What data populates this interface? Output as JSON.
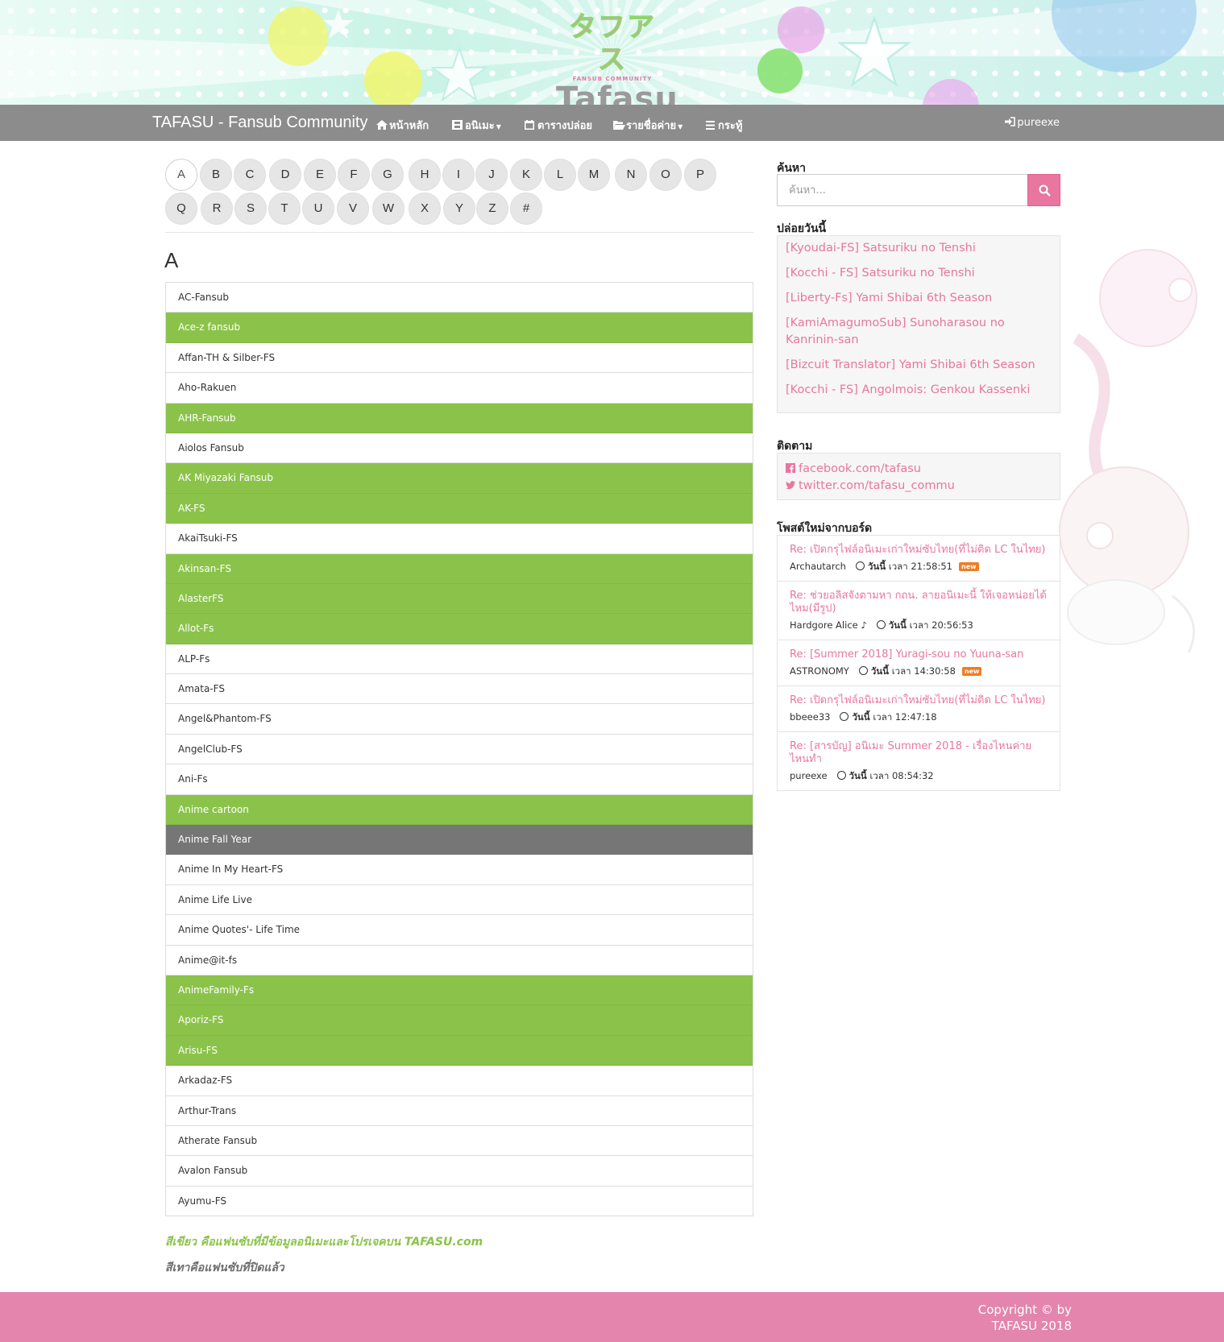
{
  "header": {
    "logo_jp": "タフアス",
    "logo_tagline": "FANSUB COMMUNITY",
    "logo_en": "Tafasu"
  },
  "navbar": {
    "brand": "TAFASU - Fansub Community",
    "items": [
      {
        "label": "หน้าหลัก",
        "icon": "home-icon"
      },
      {
        "label": "อนิเมะ",
        "icon": "film-icon",
        "dropdown": true
      },
      {
        "label": "ตารางปล่อย",
        "icon": "calendar-icon"
      },
      {
        "label": "รายชื่อค่าย",
        "icon": "folder-open-icon",
        "dropdown": true
      },
      {
        "label": "กระทู้",
        "icon": "list-icon"
      }
    ],
    "user": {
      "label": "pureexe",
      "icon": "sign-in-icon"
    }
  },
  "letters": [
    "A",
    "B",
    "C",
    "D",
    "E",
    "F",
    "G",
    "H",
    "I",
    "J",
    "K",
    "L",
    "M",
    "N",
    "O",
    "P",
    "Q",
    "R",
    "S",
    "T",
    "U",
    "V",
    "W",
    "X",
    "Y",
    "Z",
    "#"
  ],
  "active_letter": "A",
  "section_heading": "A",
  "fansubs": [
    {
      "name": "AC-Fansub",
      "status": "default"
    },
    {
      "name": "Ace-z fansub",
      "status": "green"
    },
    {
      "name": "Affan-TH & Silber-FS",
      "status": "default"
    },
    {
      "name": "Aho-Rakuen",
      "status": "default"
    },
    {
      "name": "AHR-Fansub",
      "status": "green"
    },
    {
      "name": "Aiolos Fansub",
      "status": "default"
    },
    {
      "name": "AK Miyazaki Fansub",
      "status": "green"
    },
    {
      "name": "AK-FS",
      "status": "green"
    },
    {
      "name": "AkaiTsuki-FS",
      "status": "default"
    },
    {
      "name": "Akinsan-FS",
      "status": "green"
    },
    {
      "name": "AlasterFS",
      "status": "green"
    },
    {
      "name": "Allot-Fs",
      "status": "green"
    },
    {
      "name": "ALP-Fs",
      "status": "default"
    },
    {
      "name": "Amata-FS",
      "status": "default"
    },
    {
      "name": "Angel&Phantom-FS",
      "status": "default"
    },
    {
      "name": "AngelClub-FS",
      "status": "default"
    },
    {
      "name": "Ani-Fs",
      "status": "default"
    },
    {
      "name": "Anime cartoon",
      "status": "green"
    },
    {
      "name": "Anime Fall Year",
      "status": "gray"
    },
    {
      "name": "Anime In My Heart-FS",
      "status": "default"
    },
    {
      "name": "Anime Life Live",
      "status": "default"
    },
    {
      "name": "Anime Quotes'- Life Time",
      "status": "default"
    },
    {
      "name": "Anime@it-fs",
      "status": "default"
    },
    {
      "name": "AnimeFamily-Fs",
      "status": "green"
    },
    {
      "name": "Aporiz-FS",
      "status": "green"
    },
    {
      "name": "Arisu-FS",
      "status": "green"
    },
    {
      "name": "Arkadaz-FS",
      "status": "default"
    },
    {
      "name": "Arthur-Trans",
      "status": "default"
    },
    {
      "name": "Atherate Fansub",
      "status": "default"
    },
    {
      "name": "Avalon Fansub",
      "status": "default"
    },
    {
      "name": "Ayumu-FS",
      "status": "default"
    }
  ],
  "legend": {
    "green": "สีเขียว คือแฟนซับที่มีข้อมูลอนิเมะและโปรเจคบน TAFASU.com",
    "gray": "สีเทาคือแฟนซับที่ปิดแล้ว"
  },
  "sidebar": {
    "search": {
      "title": "ค้นหา",
      "placeholder": "ค้นหา...",
      "button_icon": "search-icon"
    },
    "today": {
      "title": "ปล่อยวันนี้",
      "items": [
        "[Kyoudai-FS] Satsuriku no Tenshi",
        "[Kocchi - FS] Satsuriku no Tenshi",
        "[Liberty-Fs] Yami Shibai 6th Season",
        "[KamiAmagumoSub] Sunoharasou no Kanrinin-san",
        "[Bizcuit Translator] Yami Shibai 6th Season",
        "[Kocchi - FS] Angolmois: Genkou Kassenki"
      ]
    },
    "follow": {
      "title": "ติดตาม",
      "facebook": "facebook.com/tafasu",
      "twitter": "twitter.com/tafasu_commu"
    },
    "board": {
      "title": "โพสต์ใหม่จากบอร์ด",
      "posts": [
        {
          "title": "Re: เปิดกรุไฟล์อนิเมะเก่าใหม่ซับไทย(ที่ไม่ติด LC ในไทย)",
          "author": "Archautarch",
          "day": "วันนี้",
          "time_prefix": "เวลา",
          "time": "21:58:51",
          "new": "new"
        },
        {
          "title": "Re: ช่วยอลิสจังตามหา กถน. ลายอนิเมะนี้ ให้เจอหน่อยได้ไหม(มีรูป)",
          "author": "Hardgore Alice ♪",
          "day": "วันนี้",
          "time_prefix": "เวลา",
          "time": "20:56:53",
          "new": ""
        },
        {
          "title": "Re: [Summer 2018] Yuragi-sou no Yuuna-san",
          "author": "ASTRONOMY",
          "day": "วันนี้",
          "time_prefix": "เวลา",
          "time": "14:30:58",
          "new": "new"
        },
        {
          "title": "Re: เปิดกรุไฟล์อนิเมะเก่าใหม่ซับไทย(ที่ไม่ติด LC ในไทย)",
          "author": "bbeee33",
          "day": "วันนี้",
          "time_prefix": "เวลา",
          "time": "12:47:18",
          "new": ""
        },
        {
          "title": "Re: [สารบัญ] อนิเมะ Summer 2018 - เรื่องไหนค่ายไหนทำ",
          "author": "pureexe",
          "day": "วันนี้",
          "time_prefix": "เวลา",
          "time": "08:54:32",
          "new": ""
        }
      ]
    }
  },
  "footer": {
    "line1": "Copyright © by",
    "line2": "TAFASU 2018"
  },
  "colors": {
    "nav": "#8c8c8c",
    "green": "#8bc34a",
    "gray": "#767676",
    "pink": "#e8769f",
    "footer": "#e385ad"
  }
}
